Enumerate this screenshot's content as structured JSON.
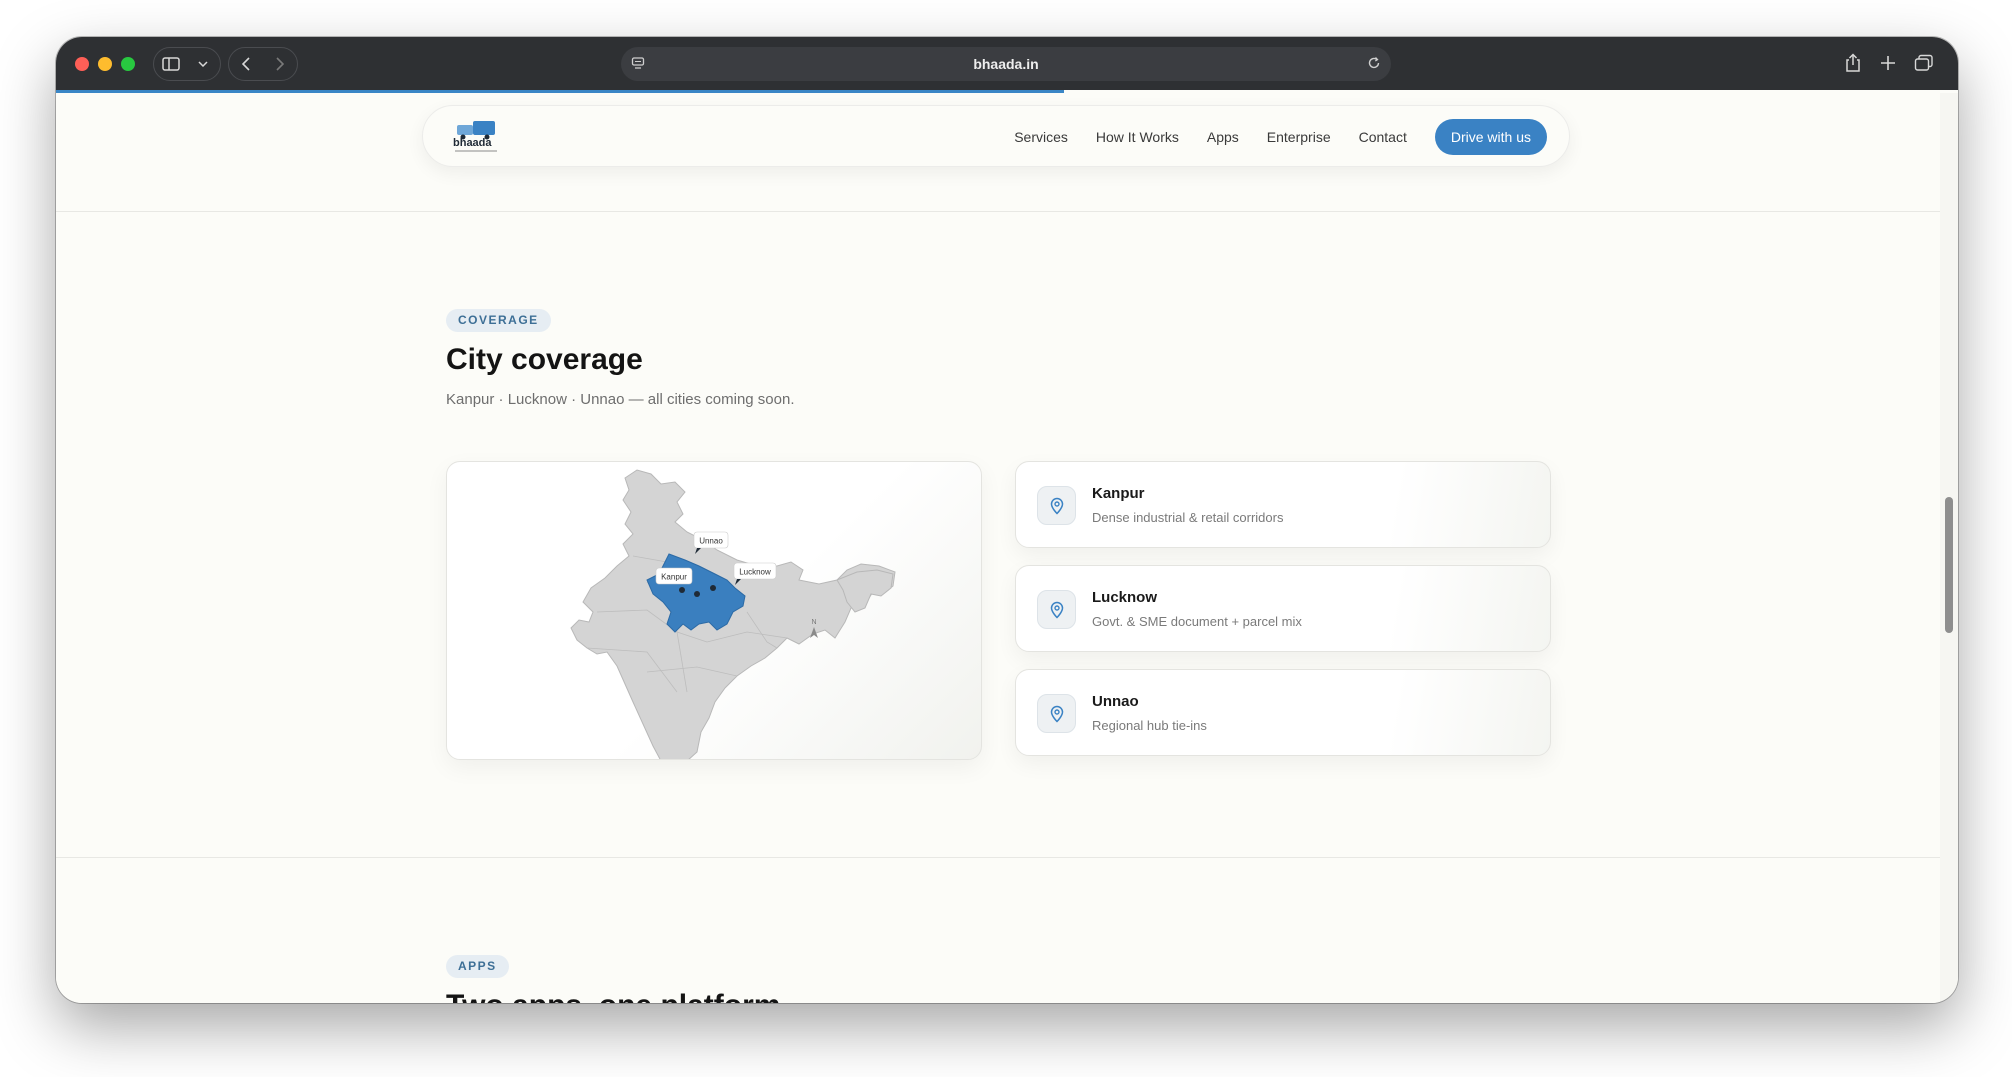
{
  "browser": {
    "url": "bhaada.in",
    "load_progress": 0.53
  },
  "nav": {
    "logo_text": "bhaada",
    "links": [
      "Services",
      "How It Works",
      "Apps",
      "Enterprise",
      "Contact"
    ],
    "cta": "Drive with us"
  },
  "coverage": {
    "badge": "COVERAGE",
    "title": "City coverage",
    "subtitle": "Kanpur · Lucknow · Unnao — all cities coming soon.",
    "map_labels": {
      "kanpur": "Kanpur",
      "lucknow": "Lucknow",
      "unnao": "Unnao",
      "compass": "N"
    },
    "cities": [
      {
        "name": "Kanpur",
        "desc": "Dense industrial & retail corridors"
      },
      {
        "name": "Lucknow",
        "desc": "Govt. & SME document + parcel mix"
      },
      {
        "name": "Unnao",
        "desc": "Regional hub tie-ins"
      }
    ]
  },
  "apps": {
    "badge": "APPS",
    "title": "Two apps, one platform"
  },
  "colors": {
    "accent": "#3a82c4",
    "page_bg": "#fcfcf8",
    "map_state": "#3a7fbf",
    "map_land": "#d4d4d4"
  }
}
